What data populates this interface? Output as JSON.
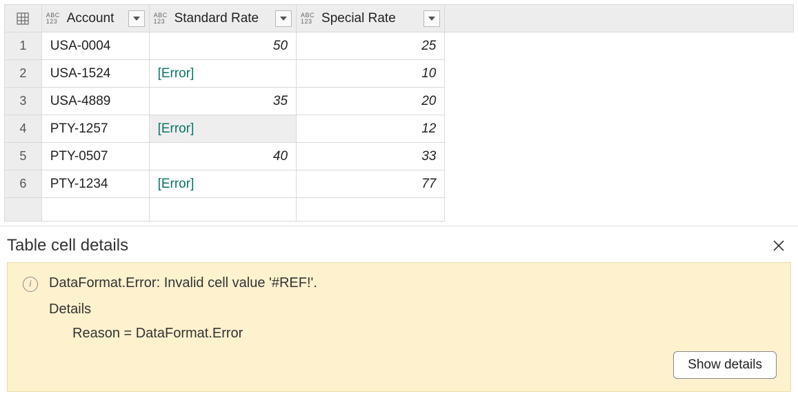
{
  "table": {
    "columns": [
      {
        "name": "Account",
        "type_label_top": "ABC",
        "type_label_bottom": "123"
      },
      {
        "name": "Standard Rate",
        "type_label_top": "ABC",
        "type_label_bottom": "123"
      },
      {
        "name": "Special Rate",
        "type_label_top": "ABC",
        "type_label_bottom": "123"
      }
    ],
    "rows": [
      {
        "num": "1",
        "account": "USA-0004",
        "standard": "50",
        "standard_error": false,
        "special": "25"
      },
      {
        "num": "2",
        "account": "USA-1524",
        "standard": "[Error]",
        "standard_error": true,
        "special": "10"
      },
      {
        "num": "3",
        "account": "USA-4889",
        "standard": "35",
        "standard_error": false,
        "special": "20"
      },
      {
        "num": "4",
        "account": "PTY-1257",
        "standard": "[Error]",
        "standard_error": true,
        "special": "12",
        "selected": true
      },
      {
        "num": "5",
        "account": "PTY-0507",
        "standard": "40",
        "standard_error": false,
        "special": "33"
      },
      {
        "num": "6",
        "account": "PTY-1234",
        "standard": "[Error]",
        "standard_error": true,
        "special": "77"
      }
    ]
  },
  "details": {
    "title": "Table cell details",
    "message": "DataFormat.Error: Invalid cell value '#REF!'.",
    "details_label": "Details",
    "reason_line": "Reason = DataFormat.Error",
    "show_details_label": "Show details"
  },
  "chart_data": {
    "type": "table",
    "columns": [
      "Account",
      "Standard Rate",
      "Special Rate"
    ],
    "rows": [
      [
        "USA-0004",
        50,
        25
      ],
      [
        "USA-1524",
        "Error",
        10
      ],
      [
        "USA-4889",
        35,
        20
      ],
      [
        "PTY-1257",
        "Error",
        12
      ],
      [
        "PTY-0507",
        40,
        33
      ],
      [
        "PTY-1234",
        "Error",
        77
      ]
    ]
  }
}
